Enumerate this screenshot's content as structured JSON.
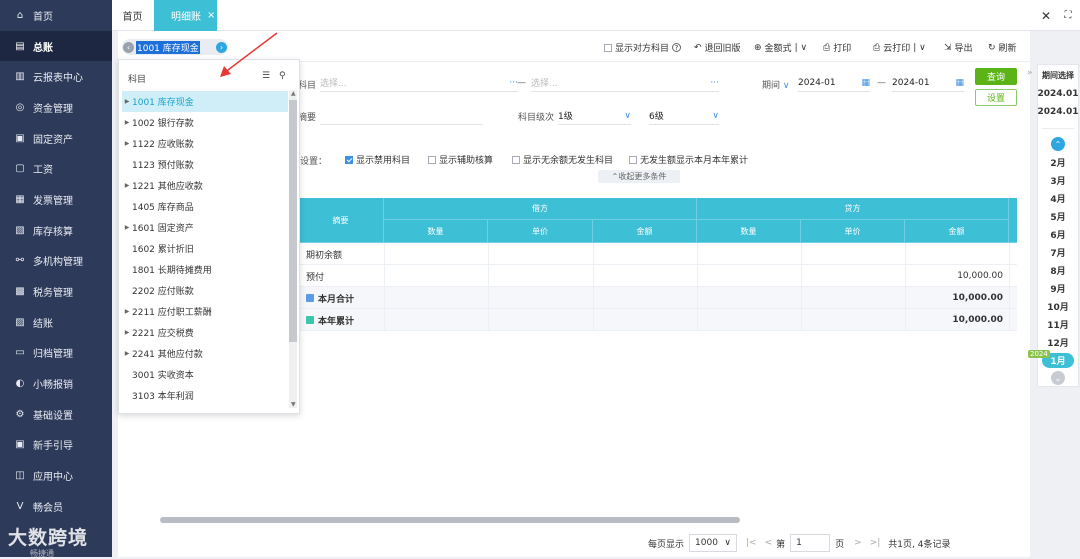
{
  "sidebar": {
    "items": [
      {
        "label": "首页",
        "icon": "home-icon"
      },
      {
        "label": "总账",
        "icon": "ledger-icon",
        "active": true
      },
      {
        "label": "云报表中心",
        "icon": "chart-icon"
      },
      {
        "label": "资金管理",
        "icon": "fund-icon"
      },
      {
        "label": "固定资产",
        "icon": "asset-icon"
      },
      {
        "label": "工资",
        "icon": "salary-icon"
      },
      {
        "label": "发票管理",
        "icon": "invoice-icon"
      },
      {
        "label": "库存核算",
        "icon": "inventory-icon"
      },
      {
        "label": "多机构管理",
        "icon": "org-icon"
      },
      {
        "label": "税务管理",
        "icon": "tax-icon"
      },
      {
        "label": "结账",
        "icon": "close-books-icon"
      },
      {
        "label": "归档管理",
        "icon": "archive-icon"
      },
      {
        "label": "小畅报销",
        "icon": "expense-icon"
      },
      {
        "label": "基础设置",
        "icon": "settings-icon"
      },
      {
        "label": "新手引导",
        "icon": "guide-icon"
      },
      {
        "label": "应用中心",
        "icon": "apps-icon"
      },
      {
        "label": "畅会员",
        "icon": "vip-icon"
      }
    ],
    "brand": "大数跨境",
    "brand_sub": "畅捷通"
  },
  "tabs": {
    "home": "首页",
    "active": "明细账",
    "close": "×"
  },
  "window": {
    "close": "✕",
    "fullscreen": "⛶"
  },
  "toolbar": {
    "account": "1001 库存现金",
    "show_counter": "显示对方科目",
    "back": "退回旧版",
    "amount_format": "金额式",
    "print": "打印",
    "cloud_print": "云打印",
    "export": "导出",
    "refresh": "刷新"
  },
  "filters": {
    "subject_label": "科目",
    "subject_placeholder": "选择...",
    "subject_to_placeholder": "选择...",
    "period_label": "期间",
    "period_from": "2024-01",
    "period_to": "2024-01",
    "summary_label": "摘要",
    "level_label": "科目级次",
    "level_from": "1级",
    "level_to": "6级",
    "settings_label": "设置：",
    "opt1": "显示禁用科目",
    "opt2": "显示辅助核算",
    "opt3": "显示无余额无发生科目",
    "opt4": "无发生额显示本月本年累计",
    "collapse": "收起更多条件",
    "query": "查询",
    "settings": "设置"
  },
  "grid": {
    "summary_header": "摘要",
    "debit": "借方",
    "credit": "贷方",
    "qty": "数量",
    "price": "单价",
    "amount": "金额",
    "rows": [
      {
        "summary": "期初余额",
        "credit_amount": ""
      },
      {
        "summary": "预付",
        "credit_amount": "10,000.00"
      },
      {
        "summary": "本月合计",
        "credit_amount": "10,000.00"
      },
      {
        "summary": "本年累计",
        "credit_amount": "10,000.00"
      }
    ]
  },
  "pager": {
    "per_page_label": "每页显示",
    "per_page": "1000",
    "page_prefix": "第",
    "page": "1",
    "page_suffix": "页",
    "summary": "共1页, 4条记录"
  },
  "period_panel": {
    "title": "期间选择",
    "from": "2024.01",
    "to": "2024.01",
    "months": [
      "2月",
      "3月",
      "4月",
      "5月",
      "6月",
      "7月",
      "8月",
      "9月",
      "10月",
      "11月",
      "12月"
    ],
    "current": "1月",
    "year_badge": "2024"
  },
  "popup": {
    "title": "科目",
    "items": [
      {
        "label": "1001 库存现金",
        "arrow": true,
        "selected": true
      },
      {
        "label": "1002 银行存款",
        "arrow": true
      },
      {
        "label": "1122 应收账款",
        "arrow": true
      },
      {
        "label": "1123 预付账款",
        "arrow": false
      },
      {
        "label": "1221 其他应收款",
        "arrow": true
      },
      {
        "label": "1405 库存商品",
        "arrow": false
      },
      {
        "label": "1601 固定资产",
        "arrow": true
      },
      {
        "label": "1602 累计折旧",
        "arrow": false
      },
      {
        "label": "1801 长期待摊费用",
        "arrow": false
      },
      {
        "label": "2202 应付账款",
        "arrow": false
      },
      {
        "label": "2211 应付职工薪酬",
        "arrow": true
      },
      {
        "label": "2221 应交税费",
        "arrow": true
      },
      {
        "label": "2241 其他应付款",
        "arrow": true
      },
      {
        "label": "3001 实收资本",
        "arrow": false
      },
      {
        "label": "3103 本年利润",
        "arrow": false
      }
    ]
  }
}
